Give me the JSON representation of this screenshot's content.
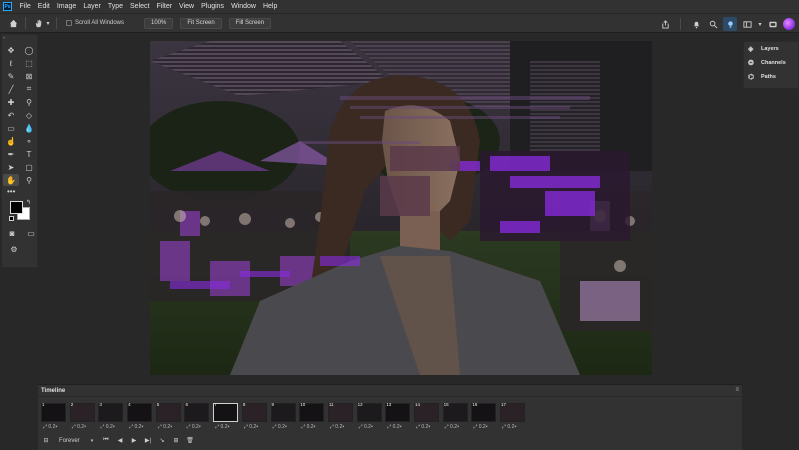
{
  "app": {
    "logo": "Ps"
  },
  "menu": [
    "File",
    "Edit",
    "Image",
    "Layer",
    "Type",
    "Select",
    "Filter",
    "View",
    "Plugins",
    "Window",
    "Help"
  ],
  "options_bar": {
    "scroll_all_windows": "Scroll All Windows",
    "zoom_100": "100%",
    "fit_screen": "Fit Screen",
    "fill_screen": "Fill Screen"
  },
  "panels": {
    "layers": "Layers",
    "channels": "Channels",
    "paths": "Paths"
  },
  "timeline": {
    "title": "Timeline",
    "loop": "Forever",
    "frames": [
      {
        "num": "1",
        "dur": "0.2"
      },
      {
        "num": "2",
        "dur": "0.2"
      },
      {
        "num": "3",
        "dur": "0.2"
      },
      {
        "num": "4",
        "dur": "0.2"
      },
      {
        "num": "5",
        "dur": "0.2"
      },
      {
        "num": "6",
        "dur": "0.2"
      },
      {
        "num": "7",
        "dur": "0.2"
      },
      {
        "num": "8",
        "dur": "0.2"
      },
      {
        "num": "9",
        "dur": "0.2"
      },
      {
        "num": "10",
        "dur": "0.2"
      },
      {
        "num": "11",
        "dur": "0.2"
      },
      {
        "num": "12",
        "dur": "0.2"
      },
      {
        "num": "13",
        "dur": "0.2"
      },
      {
        "num": "14",
        "dur": "0.2"
      },
      {
        "num": "15",
        "dur": "0.2"
      },
      {
        "num": "16",
        "dur": "0.2"
      },
      {
        "num": "17",
        "dur": "0.2"
      }
    ],
    "selected_frame": "7"
  },
  "colors": {
    "foreground": "#000000",
    "background": "#ffffff",
    "accent": "#8a2be2"
  }
}
